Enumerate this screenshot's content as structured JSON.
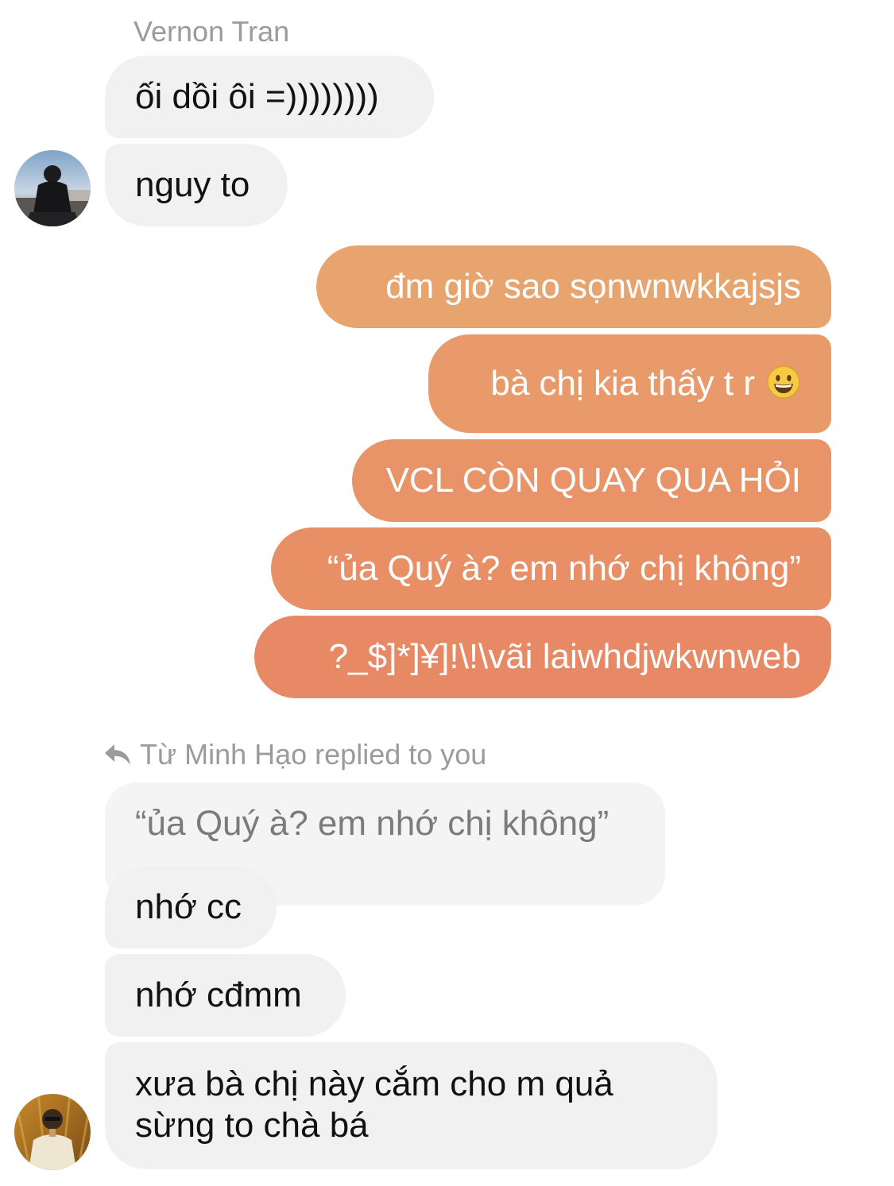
{
  "thread": {
    "sender_name": "Vernon Tran",
    "incoming_1": [
      "ối dồi ôi =))))))))",
      "nguy to"
    ],
    "outgoing": [
      "đm giờ sao sọnwnwkkajsjs",
      "bà chị kia thấy t r",
      "VCL CÒN QUAY QUA HỎI",
      "“ủa Quý à? em nhớ chị không”",
      "?_$]*]¥]!\\!\\vãi laiwhdjwkwnweb"
    ],
    "outgoing_colors": [
      "#e8a46e",
      "#e89a6a",
      "#e89468",
      "#e88f66",
      "#e88966"
    ],
    "reply": {
      "header": "Từ Minh Hạo replied to you",
      "quoted_text": "“ủa Quý à? em nhớ chị không”",
      "messages": [
        "nhớ cc",
        "nhớ cđmm",
        "xưa bà chị này cắm cho m quả",
        "sừng to chà bá"
      ]
    },
    "icons": {
      "reply_arrow": "reply-arrow-icon",
      "emoji": "grinning-face-emoji"
    }
  }
}
